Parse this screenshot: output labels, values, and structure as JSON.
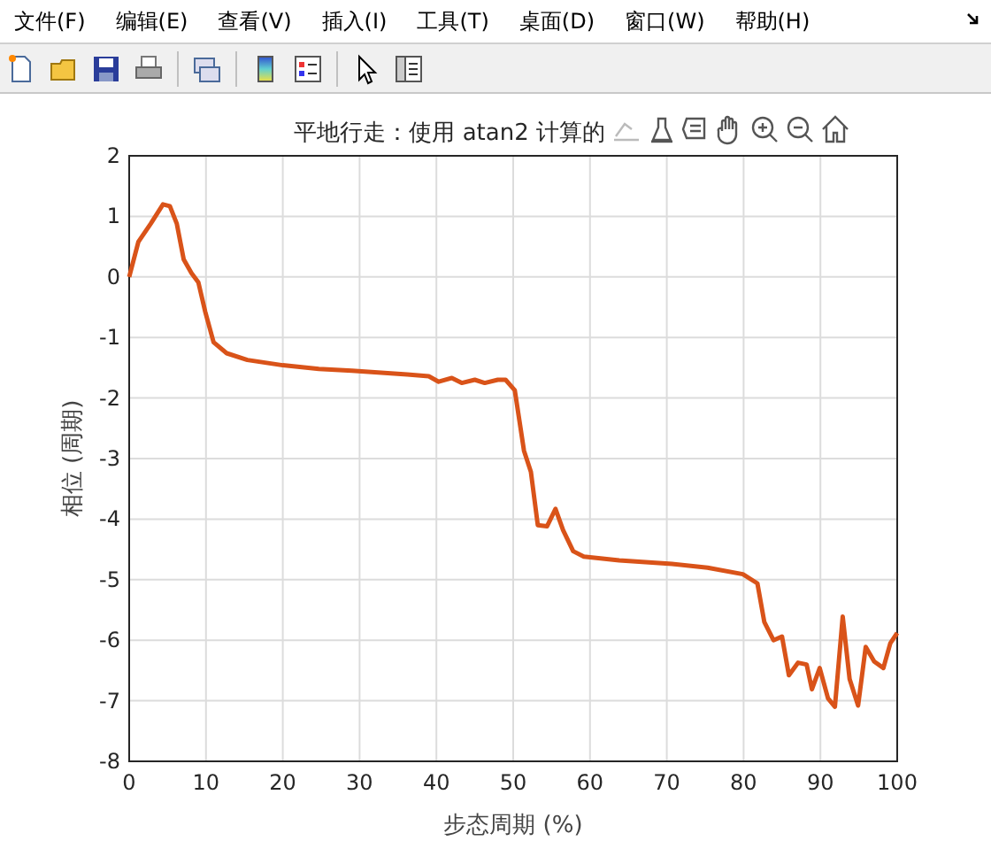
{
  "menu": [
    "文件(F)",
    "编辑(E)",
    "查看(V)",
    "插入(I)",
    "工具(T)",
    "桌面(D)",
    "窗口(W)",
    "帮助(H)"
  ],
  "figure": {
    "chart_data": {
      "type": "line",
      "grid": true,
      "title": "平地行走：使用 atan2 计算的",
      "xlabel": "步态周期 (%)",
      "ylabel": "相位 (周期)",
      "xlim": [
        0,
        100
      ],
      "ylim": [
        -8,
        2
      ],
      "xticks": [
        0,
        10,
        20,
        30,
        40,
        50,
        60,
        70,
        80,
        90,
        100
      ],
      "yticks": [
        -8,
        -7,
        -6,
        -5,
        -4,
        -3,
        -2,
        -1,
        0,
        1,
        2
      ],
      "x": [
        0,
        1.2,
        2.8,
        4.4,
        5.3,
        6.2,
        7.1,
        8.1,
        9,
        9.9,
        11,
        12.7,
        15.4,
        20,
        24.7,
        29,
        36.2,
        39,
        40.3,
        42,
        43.3,
        45,
        46.3,
        48,
        49,
        50.2,
        51.4,
        52.3,
        53.2,
        54.4,
        55.5,
        56.5,
        57.8,
        59.2,
        63.8,
        70.7,
        75.3,
        79.9,
        81.8,
        82.7,
        83.9,
        85,
        85.9,
        87.1,
        88.2,
        88.9,
        89.9,
        91,
        91.9,
        92.9,
        93.8,
        94.9,
        95.9,
        97,
        98.2,
        99.1,
        100
      ],
      "series": [
        {
          "color": "#d95319",
          "values": [
            0,
            0.58,
            0.88,
            1.2,
            1.17,
            0.88,
            0.29,
            0.06,
            -0.09,
            -0.58,
            -1.08,
            -1.26,
            -1.37,
            -1.46,
            -1.52,
            -1.55,
            -1.61,
            -1.64,
            -1.73,
            -1.67,
            -1.75,
            -1.7,
            -1.75,
            -1.7,
            -1.7,
            -1.87,
            -2.87,
            -3.22,
            -4.1,
            -4.12,
            -3.83,
            -4.18,
            -4.53,
            -4.62,
            -4.68,
            -4.74,
            -4.8,
            -4.91,
            -5.06,
            -5.7,
            -6.0,
            -5.94,
            -6.58,
            -6.37,
            -6.4,
            -6.81,
            -6.46,
            -6.96,
            -7.1,
            -5.61,
            -6.64,
            -7.08,
            -6.11,
            -6.35,
            -6.46,
            -6.05,
            -5.88
          ]
        }
      ]
    }
  }
}
